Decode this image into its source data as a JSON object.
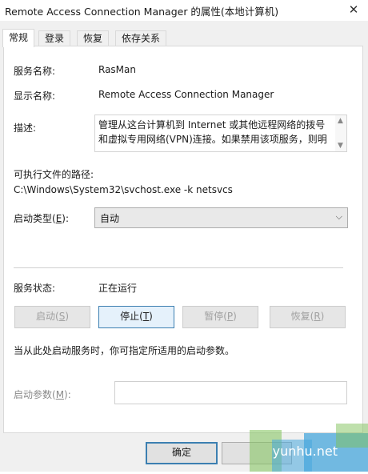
{
  "window": {
    "title": "Remote Access Connection Manager 的属性(本地计算机)",
    "close_glyph": "✕"
  },
  "tabs": [
    {
      "label": "常规",
      "active": true
    },
    {
      "label": "登录",
      "active": false
    },
    {
      "label": "恢复",
      "active": false
    },
    {
      "label": "依存关系",
      "active": false
    }
  ],
  "general": {
    "service_name_label": "服务名称:",
    "service_name": "RasMan",
    "display_name_label": "显示名称:",
    "display_name": "Remote Access Connection Manager",
    "description_label": "描述:",
    "description_line1": "管理从这台计算机到 Internet 或其他远程网络的拨号",
    "description_line2": "和虚拟专用网络(VPN)连接。如果禁用该项服务，则明",
    "exe_path_label": "可执行文件的路径:",
    "exe_path": "C:\\Windows\\System32\\svchost.exe -k netsvcs",
    "startup_type_label_pre": "启动类型(",
    "startup_type_label_key": "E",
    "startup_type_label_post": "):",
    "startup_type": "自动",
    "status_label": "服务状态:",
    "status": "正在运行",
    "hint": "当从此处启动服务时，你可指定所适用的启动参数。",
    "param_label_pre": "启动参数(",
    "param_label_key": "M",
    "param_label_post": "):",
    "param_value": ""
  },
  "buttons": {
    "start": {
      "pre": "启动(",
      "key": "S",
      "post": ")"
    },
    "stop": {
      "pre": "停止(",
      "key": "T",
      "post": ")"
    },
    "pause": {
      "pre": "暂停(",
      "key": "P",
      "post": ")"
    },
    "resume": {
      "pre": "恢复(",
      "key": "R",
      "post": ")"
    },
    "ok": "确定"
  },
  "watermark": "yunhu.net",
  "colors": {
    "accent": "#3c7fb1",
    "watermark_green": "#7fc25a",
    "watermark_blue": "#47a7dc"
  }
}
